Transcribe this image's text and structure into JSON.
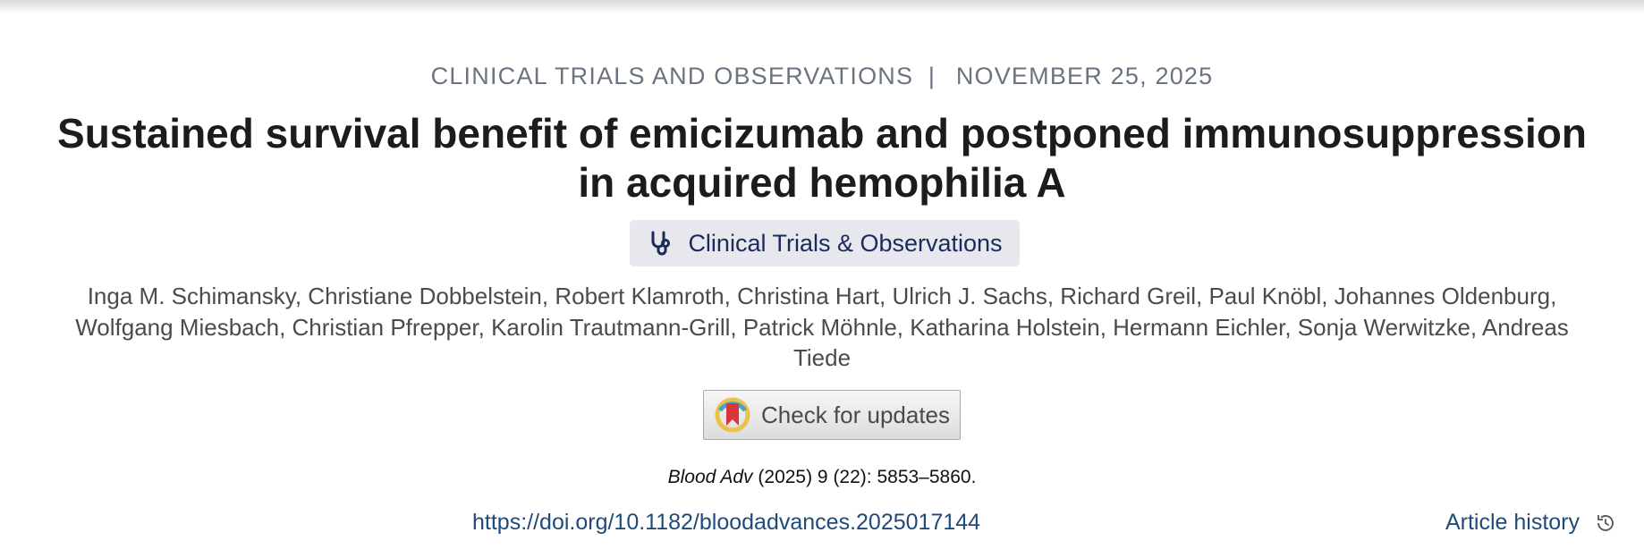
{
  "header": {
    "category": "CLINICAL TRIALS AND OBSERVATIONS",
    "separator": "|",
    "date": "NOVEMBER 25, 2025"
  },
  "article": {
    "title": "Sustained survival benefit of emicizumab and postponed immunosuppression in acquired hemophilia A",
    "badge_label": "Clinical Trials & Observations",
    "authors": "Inga M. Schimansky, Christiane Dobbelstein, Robert Klamroth, Christina Hart, Ulrich J. Sachs, Richard Greil, Paul Knöbl, Johannes Oldenburg, Wolfgang Miesbach, Christian Pfrepper, Karolin Trautmann-Grill, Patrick Möhnle, Katharina Holstein, Hermann Eichler, Sonja Werwitzke, Andreas Tiede",
    "check_updates_label": "Check for updates",
    "citation": {
      "journal": "Blood Adv",
      "details": "(2025) 9 (22): 5853–5860."
    },
    "doi": "https://doi.org/10.1182/bloodadvances.2025017144",
    "history_label": "Article history"
  },
  "icons": {
    "badge": "stethoscope-icon",
    "updates": "crossmark-icon",
    "history": "history-icon"
  },
  "colors": {
    "title": "#1c1c1c",
    "link": "#1f4a7a",
    "badge_bg": "#e6e8ee",
    "meta": "#6b7280"
  }
}
